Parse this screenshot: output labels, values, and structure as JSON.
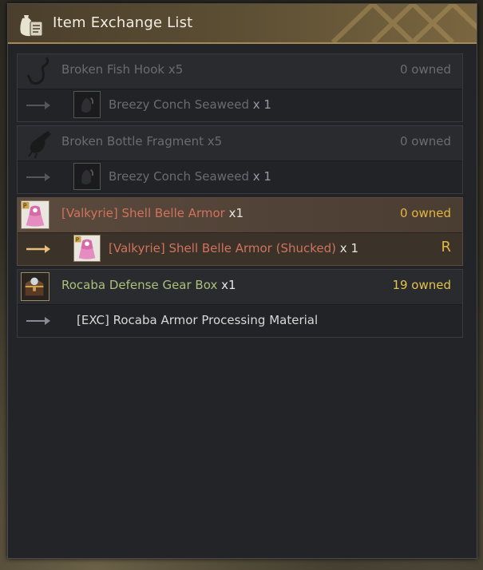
{
  "window": {
    "title": "Item Exchange List",
    "title_icon": "pouch-scroll-icon"
  },
  "entries": [
    {
      "state": "unavailable",
      "item_name": "Broken Fish Hook",
      "item_qty": "x5",
      "owned": "0 owned",
      "item_icon": "fish-hook-icon",
      "reward_name": "Breezy Conch Seaweed",
      "reward_qty": "x 1",
      "reward_icon": "seaweed-icon"
    },
    {
      "state": "unavailable",
      "item_name": "Broken Bottle Fragment",
      "item_qty": "x5",
      "owned": "0 owned",
      "item_icon": "bottle-fragment-icon",
      "reward_name": "Breezy Conch Seaweed",
      "reward_qty": "x 1",
      "reward_icon": "seaweed-icon"
    },
    {
      "state": "highlighted",
      "item_name": "[Valkyrie] Shell Belle Armor",
      "item_qty": "x1",
      "owned": "0 owned",
      "item_icon": "shell-belle-armor-icon",
      "reward_name": "[Valkyrie] Shell Belle Armor (Shucked)",
      "reward_qty": "x 1",
      "reward_icon": "shell-belle-armor-icon",
      "grade": "R"
    },
    {
      "state": "available",
      "item_name": "Rocaba Defense Gear Box",
      "item_qty": "x1",
      "owned": "19 owned",
      "item_icon": "treasure-chest-icon",
      "reward_name": "[EXC] Rocaba Armor Processing Material"
    }
  ],
  "colors": {
    "title_gold": "#a58a55",
    "owned_gold": "#e3b544",
    "highlight_red": "#d0735c",
    "available_green": "#a8c07a",
    "dim_text": "#6b6c70"
  }
}
